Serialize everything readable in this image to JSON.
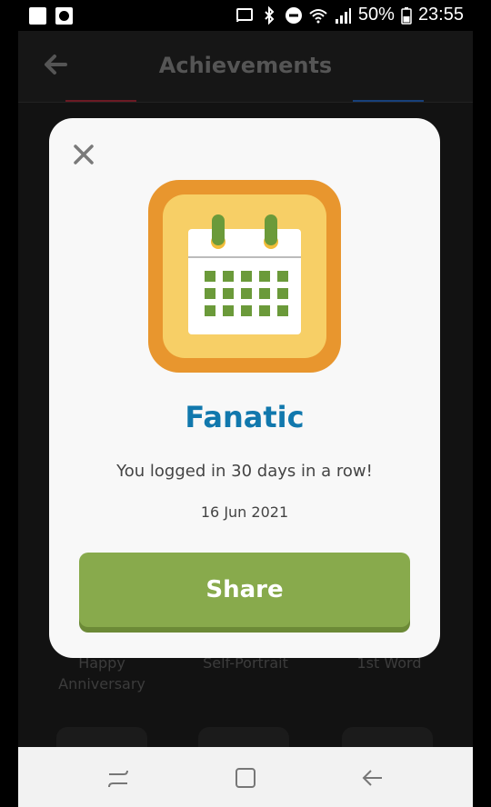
{
  "status_bar": {
    "battery": "50%",
    "time": "23:55",
    "icons": [
      "screen-cast-icon",
      "bluetooth-icon",
      "do-not-disturb-icon",
      "wifi-icon",
      "signal-icon",
      "battery-icon"
    ]
  },
  "app": {
    "title": "Achievements",
    "back_icon": "back-arrow-icon",
    "tab_underline_colors": [
      "#b3263a",
      "#1f5fbf"
    ],
    "achievements_row": [
      {
        "label": "Happy\nAnniversary"
      },
      {
        "label": "Self-Portrait"
      },
      {
        "label": "1st Word"
      }
    ]
  },
  "modal": {
    "close_icon": "close-icon",
    "badge_icon": "calendar-icon",
    "title": "Fanatic",
    "message": "You logged in 30 days in a row!",
    "date": "16 Jun 2021",
    "share_label": "Share",
    "colors": {
      "title": "#1178ad",
      "button": "#88aa4c",
      "badge_outer": "#e8962e",
      "badge_inner": "#f7cf66",
      "calendar_dots": "#6b9a3a"
    }
  },
  "nav_bar": {
    "recent_icon": "recent-apps-icon",
    "home_icon": "home-icon",
    "back_icon": "back-icon"
  }
}
